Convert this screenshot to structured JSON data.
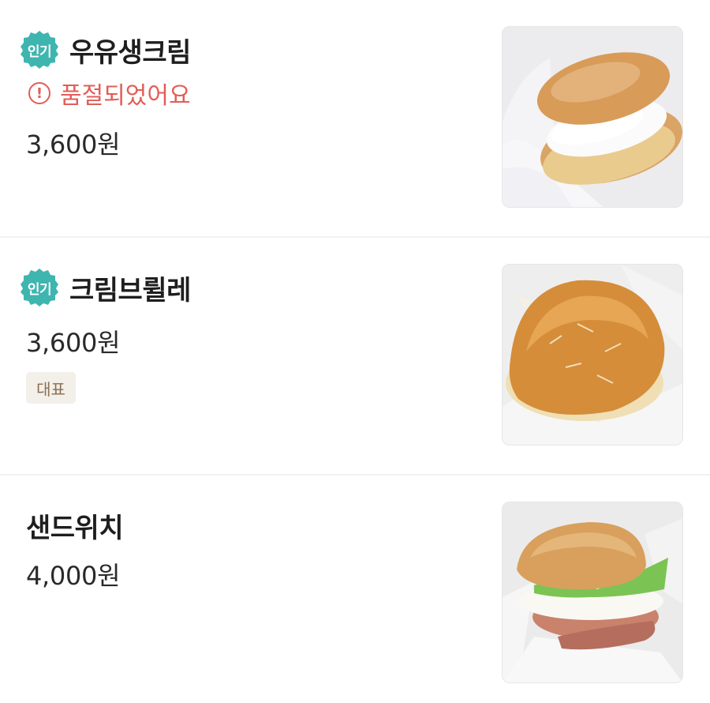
{
  "menu": {
    "items": [
      {
        "name": "우유생크림",
        "popular_badge": "인기",
        "status": "품절되었어요",
        "price": "3,600원",
        "image": "milk-cream-donut-photo"
      },
      {
        "name": "크림브륄레",
        "popular_badge": "인기",
        "price": "3,600원",
        "tag": "대표",
        "image": "creme-brulee-donut-photo"
      },
      {
        "name": "샌드위치",
        "price": "4,000원",
        "image": "sandwich-photo"
      }
    ]
  },
  "colors": {
    "popular_badge": "#3fb5b0",
    "soldout": "#e15e57",
    "tag_bg": "#f3efe9",
    "tag_text": "#8a6e52"
  },
  "icons": {
    "soldout": "alert-circle-icon",
    "popular": "scalloped-badge-icon"
  }
}
